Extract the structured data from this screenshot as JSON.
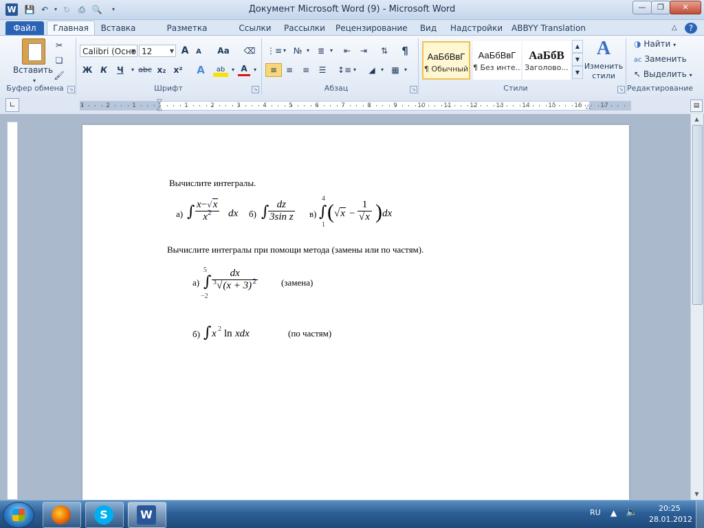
{
  "window": {
    "title": "Документ Microsoft Word (9)  -  Microsoft Word",
    "app_icon_letter": "W"
  },
  "tabs": [
    {
      "label": "Файл"
    },
    {
      "label": "Главная"
    },
    {
      "label": "Вставка"
    },
    {
      "label": "Разметка страницы"
    },
    {
      "label": "Ссылки"
    },
    {
      "label": "Рассылки"
    },
    {
      "label": "Рецензирование"
    },
    {
      "label": "Вид"
    },
    {
      "label": "Надстройки"
    },
    {
      "label": "ABBYY Translation"
    }
  ],
  "ribbon": {
    "clipboard": {
      "group": "Буфер обмена",
      "paste": "Вставить"
    },
    "font": {
      "group": "Шрифт",
      "name": "Calibri (Осно",
      "size": "12",
      "bold": "Ж",
      "italic": "К",
      "underline": "Ч",
      "strike": "abc",
      "sub": "x₂",
      "sup": "x²",
      "grow": "A",
      "shrink": "A",
      "case": "Aa"
    },
    "paragraph": {
      "group": "Абзац",
      "pilcrow": "¶"
    },
    "styles": {
      "group": "Стили",
      "items": [
        {
          "sample": "АаБбВвГ",
          "name": "¶ Обычный"
        },
        {
          "sample": "АаБбВвГ",
          "name": "¶ Без инте..."
        },
        {
          "sample": "АаБбВ",
          "name": "Заголово..."
        }
      ],
      "change": "Изменить",
      "change2": "стили"
    },
    "editing": {
      "group": "Редактирование",
      "find": "Найти",
      "replace": "Заменить",
      "select": "Выделить"
    }
  },
  "ruler": {
    "numbers": [
      "3",
      "2",
      "1",
      "1",
      "2",
      "3",
      "4",
      "5",
      "6",
      "7",
      "8",
      "9",
      "10",
      "11",
      "12",
      "13",
      "14",
      "15",
      "16",
      "17"
    ]
  },
  "document": {
    "heading1": "Вычислите интегралы.",
    "task1": {
      "a_label": "а)",
      "a_num1": "x",
      "a_minus": "−",
      "a_rad": "x",
      "a_den": "x",
      "a_pow": "2",
      "a_dx": "dx",
      "b_label": "б)",
      "b_num": "dz",
      "b_den": "3sin z",
      "c_label": "в)",
      "c_upper": "4",
      "c_lower": "1",
      "c_rad": "x",
      "c_minus": "−",
      "c_one": "1",
      "c_rad2": "x",
      "c_dx": "dx"
    },
    "heading2": "Вычислите интегралы при помощи метода (замены или по частям).",
    "task2": {
      "a_label": "а)",
      "upper": "5",
      "lower": "−2",
      "num": "dx",
      "root_index": "3",
      "den": "(x + 3)",
      "den_pow": "2",
      "hint": "(замена)"
    },
    "task3": {
      "label": "б)",
      "x": "x",
      "pow": "2",
      "ln": "ln",
      "xdx": "xdx",
      "hint": "(по частям)"
    }
  },
  "taskbar": {
    "lang": "RU",
    "time": "20:25",
    "date": "28.01.2012"
  }
}
